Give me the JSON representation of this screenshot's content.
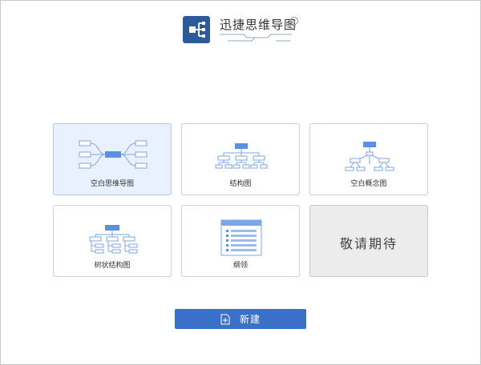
{
  "app": {
    "title": "迅捷思维导图",
    "logo_icon": "mindmap-logo-icon",
    "bulb_icon": "lightbulb-icon"
  },
  "templates": [
    {
      "label": "空白思维导图",
      "icon": "mindmap-template-icon",
      "selected": true
    },
    {
      "label": "结构图",
      "icon": "structure-chart-icon",
      "selected": false
    },
    {
      "label": "空白概念图",
      "icon": "concept-map-icon",
      "selected": false
    },
    {
      "label": "树状结构图",
      "icon": "tree-chart-icon",
      "selected": false
    },
    {
      "label": "纲领",
      "icon": "outline-icon",
      "selected": false
    },
    {
      "label": "敬请期待",
      "icon": "",
      "selected": false
    }
  ],
  "actions": {
    "new_label": "新建",
    "new_icon": "new-file-icon"
  },
  "colors": {
    "brand": "#2d5b9a",
    "accent": "#3b70c9",
    "selected_bg": "#e8f1fd",
    "node_blue": "#5b8fe0"
  }
}
